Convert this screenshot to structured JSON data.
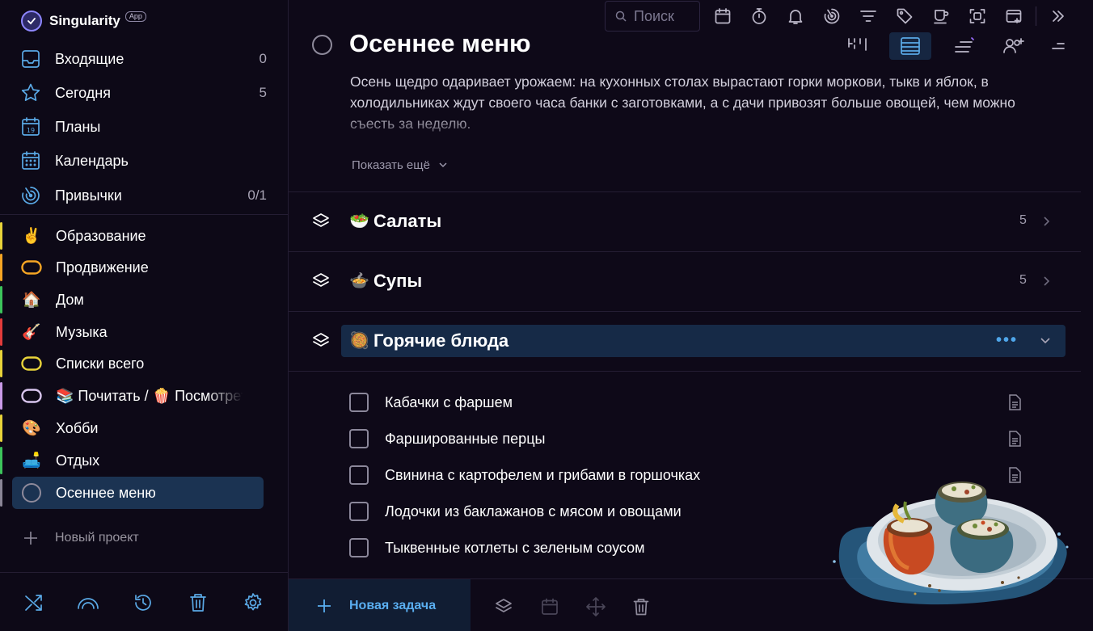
{
  "app": {
    "name": "Singularity",
    "badge": "App"
  },
  "nav": [
    {
      "id": "inbox",
      "label": "Входящие",
      "count": "0",
      "icon": "inbox-icon"
    },
    {
      "id": "today",
      "label": "Сегодня",
      "count": "5",
      "icon": "star-icon"
    },
    {
      "id": "plans",
      "label": "Планы",
      "count": "",
      "icon": "calendar-19-icon",
      "badge": "19"
    },
    {
      "id": "calendar",
      "label": "Календарь",
      "count": "",
      "icon": "calendar-grid-icon"
    },
    {
      "id": "habits",
      "label": "Привычки",
      "count": "0/1",
      "icon": "habits-target-icon"
    }
  ],
  "projects": [
    {
      "label": "Образование",
      "emoji": "✌️",
      "bar": "#e8d33a",
      "icon": "victory-hand-icon"
    },
    {
      "label": "Продвижение",
      "emoji": "",
      "bar": "#f5a524",
      "icon": "ring-orange-icon"
    },
    {
      "label": "Дом",
      "emoji": "🏠",
      "bar": "#3cc45b",
      "icon": "house-icon"
    },
    {
      "label": "Музыка",
      "emoji": "🎸",
      "bar": "#e23b3b",
      "icon": "guitar-icon"
    },
    {
      "label": "Списки всего",
      "emoji": "",
      "bar": "#e8d33a",
      "icon": "ring-yellow-icon"
    },
    {
      "label": "📚 Почитать / 🍿 Посмотреть",
      "emoji": "",
      "bar": "#c99ae8",
      "icon": "ring-lilac-icon"
    },
    {
      "label": "Хобби",
      "emoji": "🎨",
      "bar": "#e8d33a",
      "icon": "palette-icon"
    },
    {
      "label": "Отдых",
      "emoji": "🛋️",
      "bar": "#3cc45b",
      "icon": "couch-icon"
    },
    {
      "label": "Осеннее меню",
      "emoji": "",
      "bar": "#8a8596",
      "icon": "ring-gray-icon",
      "active": true
    }
  ],
  "new_project": "Новый проект",
  "search": {
    "placeholder": "Поиск"
  },
  "project": {
    "title": "Осеннее меню",
    "description": "Осень щедро одаривает урожаем: на кухонных столах вырастают горки моркови, тыкв и яблок, в холодильниках ждут своего часа банки с заготовками, а с дачи привозят больше овощей, чем можно съесть за неделю.",
    "show_more": "Показать ещё"
  },
  "headings": [
    {
      "emoji": "🥗",
      "title": "Салаты",
      "count": "5"
    },
    {
      "emoji": "🍲",
      "title": "Супы",
      "count": "5"
    },
    {
      "emoji": "🥘",
      "title": "Горячие блюда",
      "more": "•••"
    }
  ],
  "tasks": [
    "Кабачки с фаршем",
    "Фаршированные перцы",
    "Свинина с картофелем и грибами в горшочках",
    "Лодочки из баклажанов с мясом и овощами",
    "Тыквенные котлеты с зеленым соусом"
  ],
  "bottom": {
    "new_task": "Новая задача"
  },
  "colors": {
    "accent": "#5aa9e6",
    "active_bg": "#1b3352",
    "background": "#0e0918"
  }
}
